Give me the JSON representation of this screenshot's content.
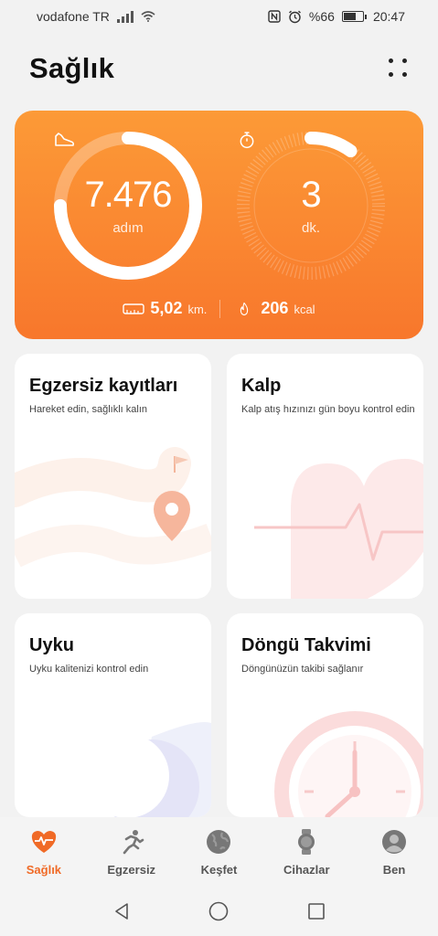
{
  "status_bar": {
    "carrier": "vodafone TR",
    "battery": "%66",
    "time": "20:47"
  },
  "header": {
    "title": "Sağlık"
  },
  "activity": {
    "steps": "7.476",
    "steps_unit": "adım",
    "steps_progress": 0.75,
    "minutes": "3",
    "minutes_unit": "dk.",
    "minutes_progress": 0.1,
    "distance_value": "5,02",
    "distance_unit": "km.",
    "calories_value": "206",
    "calories_unit": "kcal",
    "colors": {
      "card_top": "#fc9a37",
      "card_bottom": "#f8772c"
    }
  },
  "cards": {
    "exercise": {
      "title": "Egzersiz kayıtları",
      "subtitle": "Hareket edin, sağlıklı kalın"
    },
    "heart": {
      "title": "Kalp",
      "subtitle": "Kalp atış hızınızı gün boyu kontrol edin"
    },
    "sleep": {
      "title": "Uyku",
      "subtitle": "Uyku kalitenizi kontrol edin"
    },
    "cycle": {
      "title": "Döngü Takvimi",
      "subtitle": "Döngünüzün takibi sağlanır"
    }
  },
  "bottom_nav": {
    "items": [
      {
        "label": "Sağlık",
        "icon": "heart-pulse-icon",
        "active": true
      },
      {
        "label": "Egzersiz",
        "icon": "running-icon",
        "active": false
      },
      {
        "label": "Keşfet",
        "icon": "globe-icon",
        "active": false
      },
      {
        "label": "Cihazlar",
        "icon": "watch-icon",
        "active": false
      },
      {
        "label": "Ben",
        "icon": "person-icon",
        "active": false
      }
    ],
    "accent": "#f06a26"
  }
}
